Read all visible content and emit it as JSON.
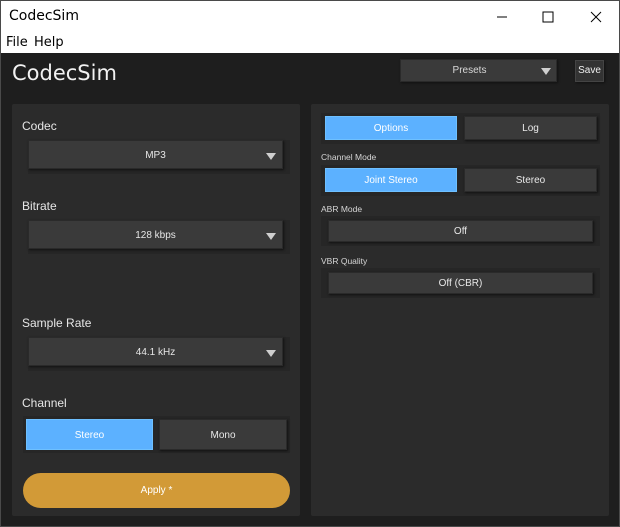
{
  "window": {
    "title": "CodecSim"
  },
  "menu": {
    "items": [
      "File",
      "Help"
    ]
  },
  "header": {
    "app_title": "CodecSim",
    "presets_label": "Presets",
    "save_label": "Save"
  },
  "left": {
    "codec": {
      "label": "Codec",
      "value": "MP3"
    },
    "bitrate": {
      "label": "Bitrate",
      "value": "128 kbps"
    },
    "sample_rate": {
      "label": "Sample Rate",
      "value": "44.1 kHz"
    },
    "channel": {
      "label": "Channel",
      "options": [
        "Stereo",
        "Mono"
      ],
      "selected": "Stereo"
    },
    "apply_label": "Apply *"
  },
  "right": {
    "tabs": [
      "Options",
      "Log"
    ],
    "active_tab": "Options",
    "channel_mode": {
      "label": "Channel Mode",
      "options": [
        "Joint Stereo",
        "Stereo"
      ],
      "selected": "Joint Stereo"
    },
    "abr_mode": {
      "label": "ABR Mode",
      "value": "Off"
    },
    "vbr_quality": {
      "label": "VBR Quality",
      "value": "Off (CBR)"
    }
  },
  "colors": {
    "accent": "#5cb1ff",
    "apply": "#d29a37",
    "background": "#1e1e1e",
    "panel": "#2b2b2b",
    "control": "#3a3a3a"
  }
}
